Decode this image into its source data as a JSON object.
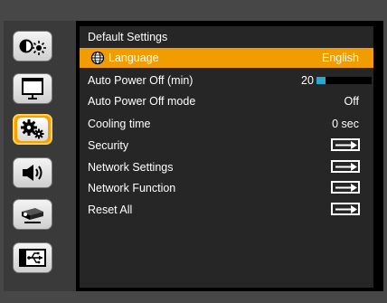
{
  "sidebar": {
    "items": [
      {
        "name": "picture-icon",
        "active": false
      },
      {
        "name": "screen-icon",
        "active": false
      },
      {
        "name": "settings-gears-icon",
        "active": true
      },
      {
        "name": "speaker-icon",
        "active": false
      },
      {
        "name": "projector-icon",
        "active": false
      },
      {
        "name": "usb-icon",
        "active": false
      }
    ]
  },
  "menu": {
    "title": "Default Settings",
    "items": [
      {
        "label": "Language",
        "value": "English",
        "selected": true,
        "icon": "globe-icon"
      },
      {
        "label": "Auto Power Off (min)",
        "value": "20",
        "slider_fraction": 0.17
      },
      {
        "label": "Auto Power Off mode",
        "value": "Off"
      },
      {
        "label": "Cooling time",
        "value": "0 sec"
      },
      {
        "label": "Security",
        "value_icon": "enter-icon"
      },
      {
        "label": "Network Settings",
        "value_icon": "enter-icon"
      },
      {
        "label": "Network Function",
        "value_icon": "enter-icon"
      },
      {
        "label": "Reset All",
        "value_icon": "enter-icon"
      }
    ]
  },
  "colors": {
    "accent": "#f19c00",
    "slider_fill": "#2aa9cf",
    "panel": "#262626"
  }
}
